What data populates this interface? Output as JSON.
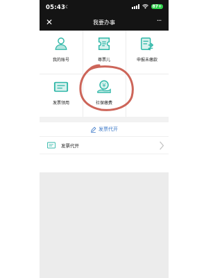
{
  "status_bar": {
    "time": "05:43",
    "battery": "87+"
  },
  "nav": {
    "title": "我要办事",
    "close_glyph": "✕",
    "more_glyph": "···"
  },
  "grid": {
    "items": [
      {
        "label": "我的账号",
        "icon": "user-account-icon"
      },
      {
        "label": "尊票儿",
        "icon": "ticket-icon"
      },
      {
        "label": "申报未缴款",
        "icon": "declare-unpaid-icon"
      },
      {
        "label": "发票领用",
        "icon": "invoice-collect-icon"
      },
      {
        "label": "社保缴费",
        "icon": "social-security-payment-icon"
      }
    ]
  },
  "section": {
    "title": "发票代开",
    "icon": "edit-icon"
  },
  "list": {
    "items": [
      {
        "label": "发票代开",
        "icon": "invoice-icon"
      }
    ]
  },
  "colors": {
    "accent": "#3b78c8",
    "icon_teal": "#2fb7a8",
    "annotation_red": "#c44a3c"
  }
}
